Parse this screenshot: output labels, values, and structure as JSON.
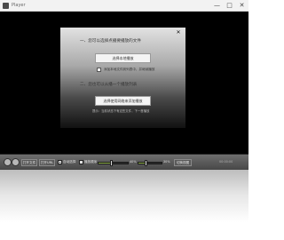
{
  "window": {
    "title": "Player",
    "minimize_glyph": "—",
    "maximize_glyph": "□",
    "close_glyph": "✕"
  },
  "dialog": {
    "close_glyph": "✕",
    "heading_local": "一、您可以选择点播要播放的文件",
    "button_local": "选择本地播放",
    "checkbox_label": "添加本地文件到列表中，并继续播放",
    "checkbox_checked": false,
    "heading_network": "二、您也可以从播一个播放列表",
    "button_network": "选择使用网络来添加播放",
    "hint": "提示：当前状态下有这些文件，下一首播放"
  },
  "controls": {
    "button_1": "打开文件",
    "button_2": "打开URL",
    "checkbox_1_label": "自动选择",
    "checkbox_1_checked": true,
    "checkbox_2_label": "播放顺序",
    "checkbox_2_checked": false,
    "progress_percent": "40%",
    "volume_percent": "30%",
    "button_3": "切换视图",
    "right_text": "00:00:00",
    "icons": [
      "player-logo-icon",
      "volume-icon"
    ],
    "accent_color": "#8fb04a"
  }
}
